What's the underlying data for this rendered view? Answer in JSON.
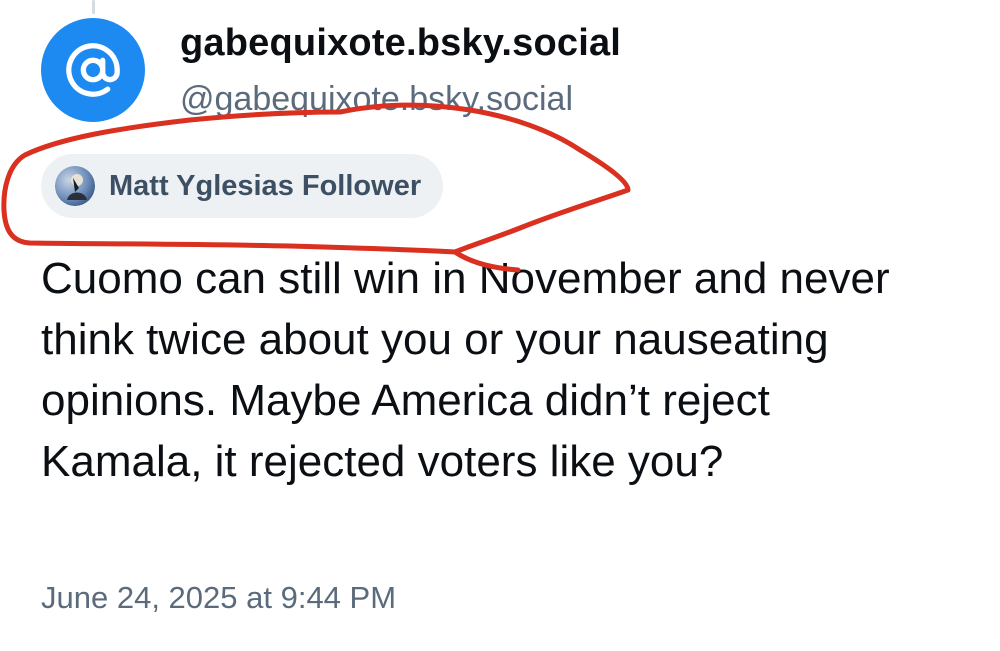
{
  "post": {
    "author": {
      "display_name": "gabequixote.bsky.social",
      "handle": "@gabequixote.bsky.social",
      "avatar_icon": "at-sign-icon",
      "avatar_color": "#1d8af2"
    },
    "badge": {
      "label": "Matt Yglesias Follower",
      "icon": "user-avatar"
    },
    "text": "Cuomo can still win in November and never think twice about you or your nauseating opinions. Maybe America didn’t reject Kamala, it rejected voters like you?",
    "timestamp": "June 24, 2025 at 9:44 PM"
  },
  "annotation": {
    "color": "#d9301f"
  }
}
